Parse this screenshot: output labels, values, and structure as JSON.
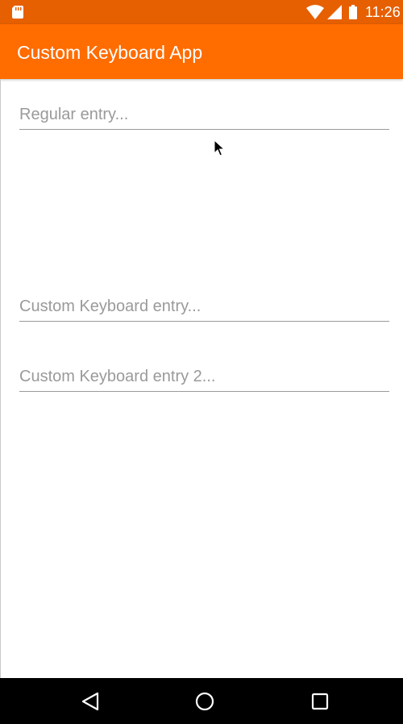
{
  "status_bar": {
    "time": "11:26",
    "icons": [
      "sd-card-icon",
      "wifi-icon",
      "signal-icon",
      "battery-icon"
    ],
    "color": "#e65f00"
  },
  "app_bar": {
    "title": "Custom Keyboard App",
    "color": "#ff6c00"
  },
  "entries": [
    {
      "placeholder": "Regular entry...",
      "value": ""
    },
    {
      "placeholder": "Custom Keyboard entry...",
      "value": ""
    },
    {
      "placeholder": "Custom Keyboard entry 2...",
      "value": ""
    }
  ],
  "nav_bar": {
    "buttons": [
      "back-icon",
      "home-icon",
      "recents-icon"
    ],
    "color": "#000000"
  }
}
